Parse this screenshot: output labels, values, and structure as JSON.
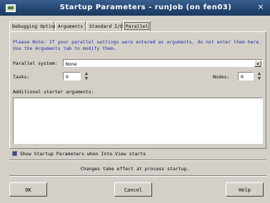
{
  "window": {
    "title": "Startup Parameters - runJob (on fen03)",
    "close_glyph": "×"
  },
  "tabs": [
    {
      "label": "Debugging Options"
    },
    {
      "label": "Arguments"
    },
    {
      "label": "Standard I/O"
    },
    {
      "label": "Parallel"
    }
  ],
  "parallel": {
    "note": "Please Note: If your parallel settings were entered as arguments, do not enter them here. Use the Arguments tab to modify them.",
    "system_label": "Parallel system:",
    "system_value": "None",
    "tasks_label": "Tasks:",
    "tasks_value": "0",
    "nodes_label": "Nodes:",
    "nodes_value": "0",
    "extra_label": "Additional starter arguments:",
    "extra_value": ""
  },
  "show_params": {
    "label": "Show Startup Parameters when Into.View starts",
    "checked": true
  },
  "footer_note": "Changes take effect at process startup.",
  "buttons": {
    "ok": "OK",
    "cancel": "Cancel",
    "help": "Help"
  }
}
